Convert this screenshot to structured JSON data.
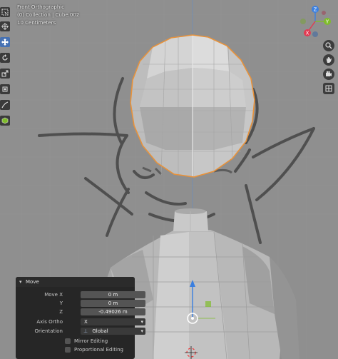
{
  "viewport": {
    "view_name": "Front Orthographic",
    "collection_path": "(0) Collection | Cube.002",
    "grid_scale": "10 Centimeters"
  },
  "gizmo": {
    "z_label": "Z",
    "y_label": "Y",
    "x_label": "X",
    "colors": {
      "x": "#e23a52",
      "y": "#7fbc2b",
      "z": "#3a7fe0"
    }
  },
  "toolbar": {
    "tools": [
      "select-box-icon",
      "cursor-icon",
      "move-icon",
      "rotate-icon",
      "scale-icon",
      "transform-icon",
      "annotate-icon",
      "measure-icon",
      "add-cube-icon"
    ],
    "active_tool": "move-icon",
    "accent_color": "#4772b3"
  },
  "nav_buttons": [
    "zoom-icon",
    "pan-hand-icon",
    "camera-icon",
    "grid-perspective-icon"
  ],
  "operator_panel": {
    "title": "Move",
    "move_x_label": "Move X",
    "move_x_value": "0 m",
    "y_label": "Y",
    "y_value": "0 m",
    "z_label": "Z",
    "z_value": "-0.49026 m",
    "axis_ortho_label": "Axis Ortho",
    "axis_ortho_value": "X",
    "orientation_label": "Orientation",
    "orientation_value": "Global",
    "mirror_editing_label": "Mirror Editing",
    "proportional_editing_label": "Proportional Editing"
  },
  "selection_outline_color": "#e8923a"
}
